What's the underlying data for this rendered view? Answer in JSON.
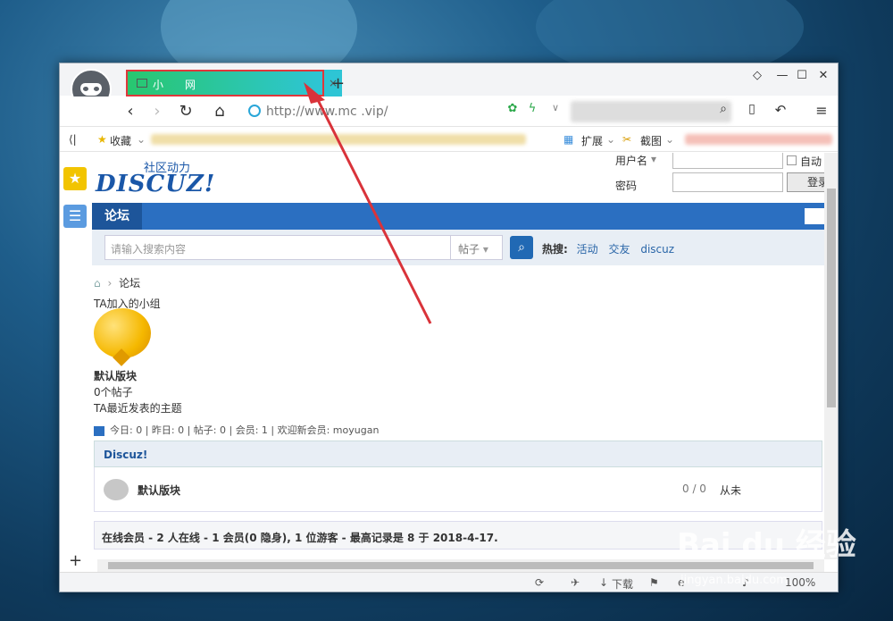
{
  "browser": {
    "tab_title": "小　　网",
    "tab_close": "×",
    "new_tab": "+",
    "url": "http://www.mc        .vip/",
    "window_controls": [
      "shirt-icon",
      "minimize-icon",
      "maximize-icon",
      "close-icon"
    ]
  },
  "bookmarks": {
    "collapse": "⟨|",
    "favorites": "收藏",
    "extensions": "扩展",
    "screenshot": "截图"
  },
  "site": {
    "logo": "DISCUZ!",
    "slogan": "社区动力",
    "login": {
      "username_label": "用户名",
      "password_label": "密码",
      "auto_label": "自动",
      "login_button": "登录"
    },
    "nav_current": "论坛",
    "search": {
      "placeholder": "请输入搜索内容",
      "type": "帖子",
      "hot_label": "热搜:",
      "hot_links": [
        "活动",
        "交友",
        "discuz"
      ]
    },
    "breadcrumb": "论坛",
    "group_heading": "TA加入的小组",
    "block_name": "默认版块",
    "post_count": "0个帖子",
    "recent_topics": "TA最近发表的主题",
    "stats": "今日: 0 | 昨日: 0 | 帖子: 0 | 会员: 1 | 欢迎新会员: moyugan",
    "category": "Discuz!",
    "forum": {
      "name": "默认版块",
      "count": "0 / 0",
      "last": "从未"
    },
    "online": "在线会员 - 2 人在线 - 1 会员(0 隐身), 1 位游客 - 最高记录是 8 于 2018-4-17."
  },
  "statusbar": {
    "download": "下载",
    "zoom": "100%"
  },
  "watermark": {
    "main": "Bai du 经验",
    "sub": "jingyan.baidu.com"
  },
  "colors": {
    "tab_gradient_start": "#28c76f",
    "tab_gradient_end": "#2ec5d5",
    "highlight_border": "#e0373b",
    "forum_nav": "#2b6fc1",
    "link": "#2a66a8"
  }
}
